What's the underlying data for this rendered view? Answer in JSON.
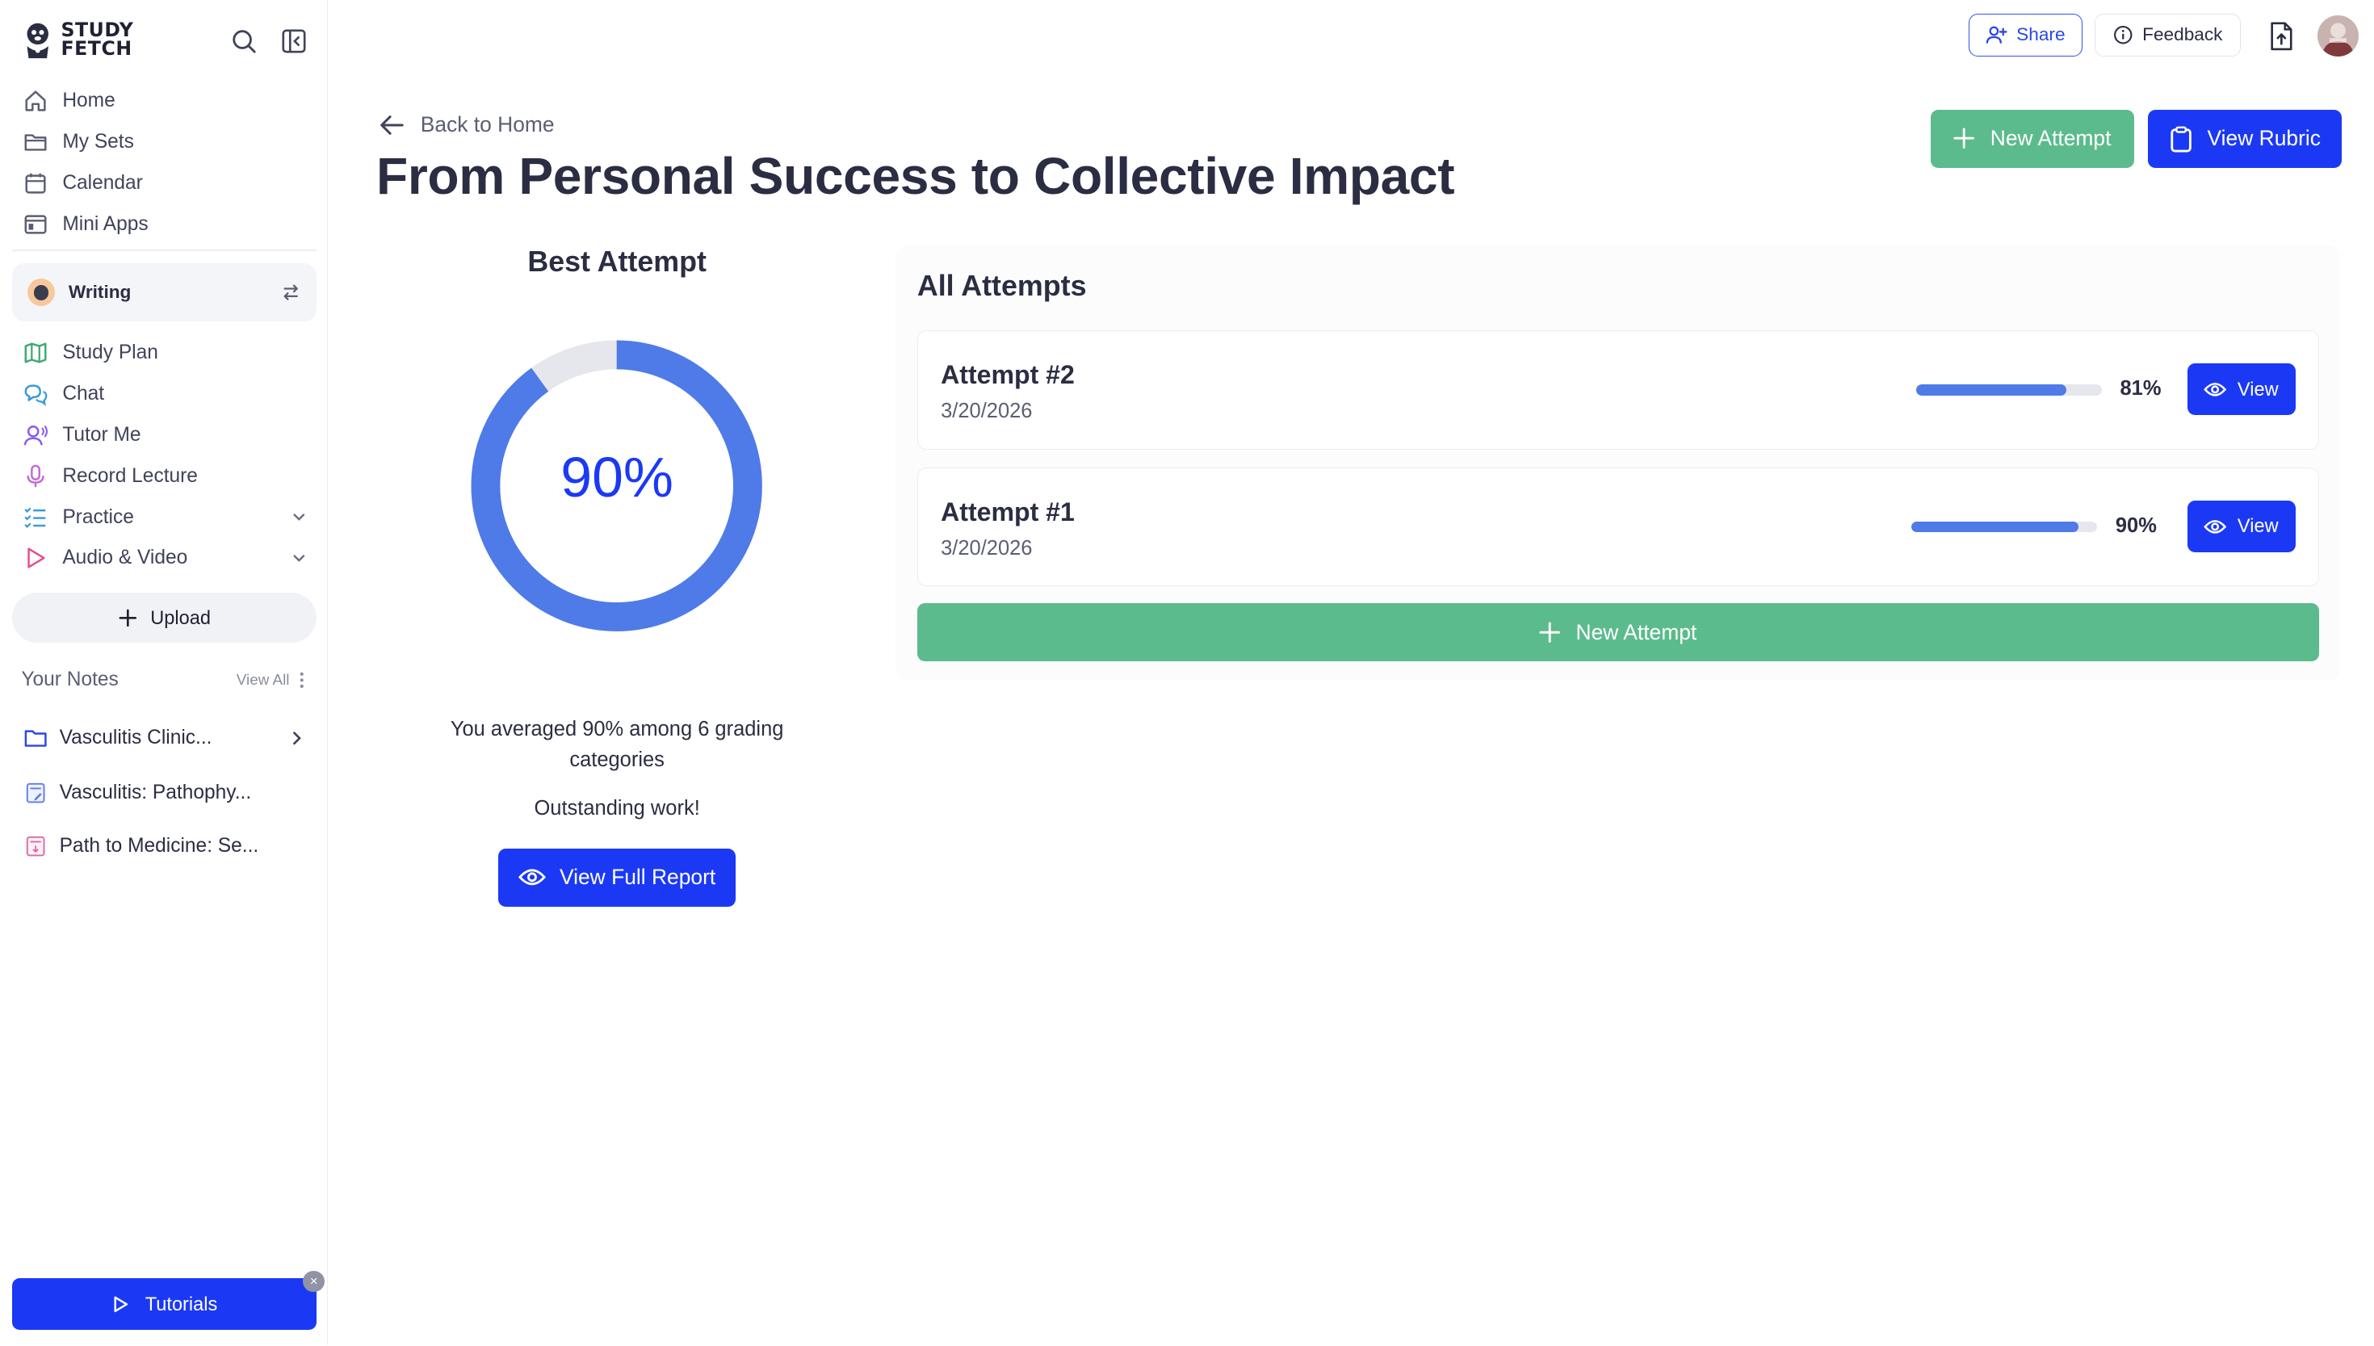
{
  "brand": {
    "line1": "STUDY",
    "line2": "FETCH"
  },
  "sidebar": {
    "nav": [
      {
        "label": "Home",
        "icon": "home-icon"
      },
      {
        "label": "My Sets",
        "icon": "folder-icon"
      },
      {
        "label": "Calendar",
        "icon": "calendar-icon"
      },
      {
        "label": "Mini Apps",
        "icon": "apps-icon"
      }
    ],
    "workspace": {
      "label": "Writing"
    },
    "tools": [
      {
        "label": "Study Plan",
        "icon": "map-icon"
      },
      {
        "label": "Chat",
        "icon": "chat-icon"
      },
      {
        "label": "Tutor Me",
        "icon": "tutor-icon"
      },
      {
        "label": "Record Lecture",
        "icon": "mic-icon"
      },
      {
        "label": "Practice",
        "icon": "list-icon"
      },
      {
        "label": "Audio & Video",
        "icon": "play-icon"
      }
    ],
    "upload_label": "Upload",
    "notes_title": "Your Notes",
    "view_all": "View All",
    "notes": [
      {
        "label": "Vasculitis Clinic..."
      },
      {
        "label": "Vasculitis: Pathophy..."
      },
      {
        "label": "Path to Medicine: Se..."
      }
    ],
    "tutorials_label": "Tutorials"
  },
  "topbar": {
    "share_label": "Share",
    "feedback_label": "Feedback"
  },
  "main": {
    "back_label": "Back to Home",
    "title": "From Personal Success to Collective Impact",
    "new_attempt_label": "New Attempt",
    "view_rubric_label": "View Rubric",
    "best_attempt": {
      "title": "Best Attempt",
      "score_text": "90%",
      "score_value": 0.9,
      "summary": "You averaged 90% among 6 grading categories",
      "comment": "Outstanding work!",
      "report_label": "View Full Report"
    },
    "attempts_title": "All Attempts",
    "attempts": [
      {
        "name": "Attempt #2",
        "date": "3/20/2026",
        "score_text": "81%",
        "score_value": 0.81,
        "view_label": "View"
      },
      {
        "name": "Attempt #1",
        "date": "3/20/2026",
        "score_text": "90%",
        "score_value": 0.9,
        "view_label": "View"
      }
    ],
    "new_attempt_bottom_label": "New Attempt"
  },
  "colors": {
    "accent": "#1b39f5",
    "success": "#5cbb8d",
    "progress": "#4f7be8",
    "track": "#e6e7ec"
  }
}
